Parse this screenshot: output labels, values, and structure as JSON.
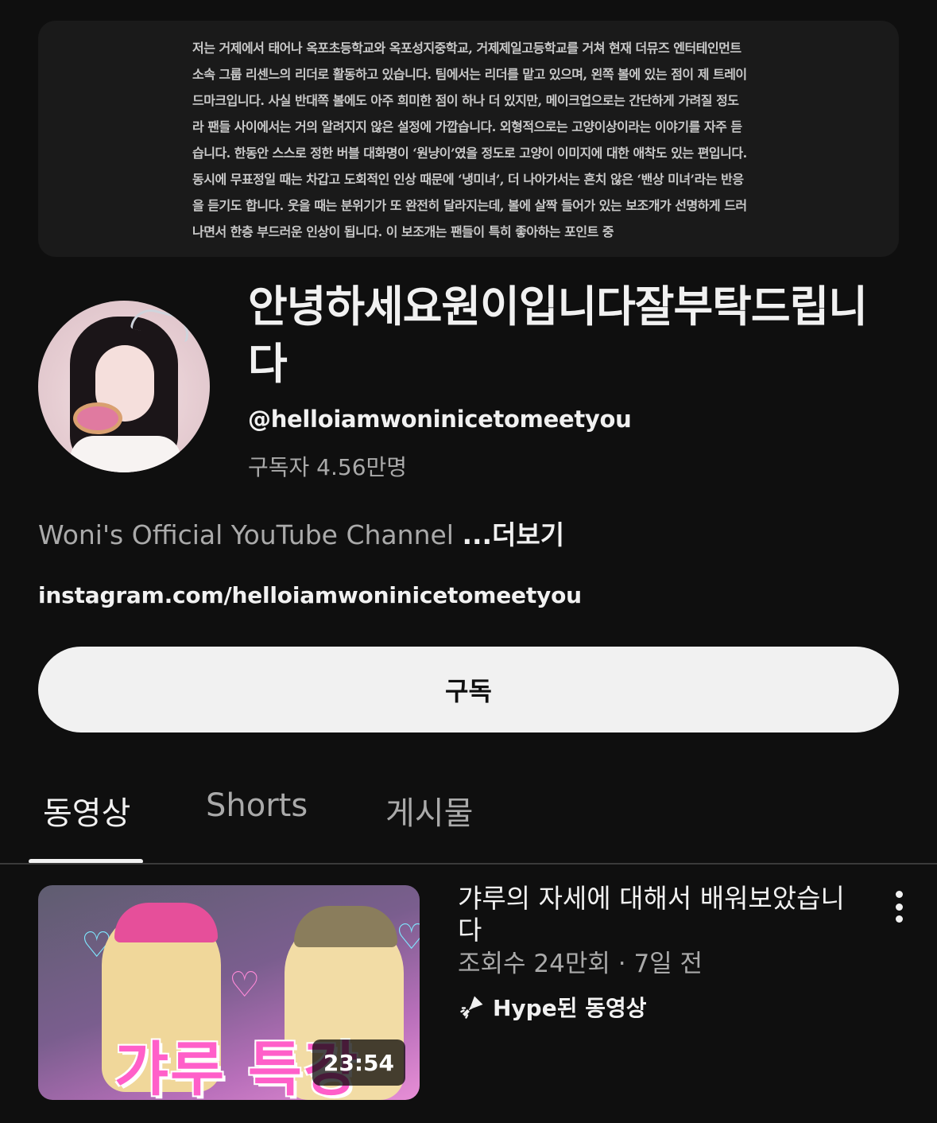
{
  "banner": {
    "text": "저는 거제에서 태어나 옥포초등학교와 옥포성지중학교, 거제제일고등학교를 거쳐 현재 더뮤즈 엔터테인먼트 소속 그룹 리센느의 리더로 활동하고 있습니다. 팀에서는 리더를 맡고 있으며, 왼쪽 볼에 있는 점이 제 트레이드마크입니다. 사실 반대쪽 볼에도 아주 희미한 점이 하나 더 있지만, 메이크업으로는 간단하게 가려질 정도라 팬들 사이에서는 거의 알려지지 않은 설정에 가깝습니다. 외형적으로는 고양이상이라는 이야기를 자주 듣습니다. 한동안 스스로 정한 버블 대화명이 ‘원냥이’였을 정도로 고양이 이미지에 대한 애착도 있는 편입니다. 동시에 무표정일 때는 차갑고 도회적인 인상 때문에 ‘냉미녀’, 더 나아가서는 흔치 않은 ‘밴상 미녀’라는 반응을 듣기도 합니다. 웃을 때는 분위기가 또 완전히 달라지는데, 볼에 살짝 들어가 있는 보조개가 선명하게 드러나면서 한층 부드러운 인상이 됩니다. 이 보조개는 팬들이 특히 좋아하는 포인트 중"
  },
  "channel": {
    "title": "안녕하세요원이입니다잘부탁드립니다",
    "handle": "@helloiamwoninicetomeetyou",
    "subscribers": "구독자 4.56만명",
    "description": "Woni's Official YouTube Channel ",
    "more_label": "...더보기",
    "link": "instagram.com/helloiamwoninicetomeetyou",
    "subscribe_label": "구독"
  },
  "tabs": [
    {
      "label": "동영상",
      "active": true
    },
    {
      "label": "Shorts",
      "active": false
    },
    {
      "label": "게시물",
      "active": false
    }
  ],
  "video": {
    "title": "갸루의 자세에 대해서 배워보았습니다",
    "meta": "조회수 24만회 · 7일 전",
    "hype_label": "Hype된 동영상",
    "duration": "23:54",
    "thumbnail_caption": "갸루 특강"
  },
  "icons": {
    "hype": "hype-rocket-icon",
    "menu": "more-vertical-icon"
  },
  "colors": {
    "background": "#0f0f0f",
    "text": "#f1f1f1",
    "secondary_text": "#aaaaaa",
    "subscribe_button": "#f1f1f1"
  }
}
